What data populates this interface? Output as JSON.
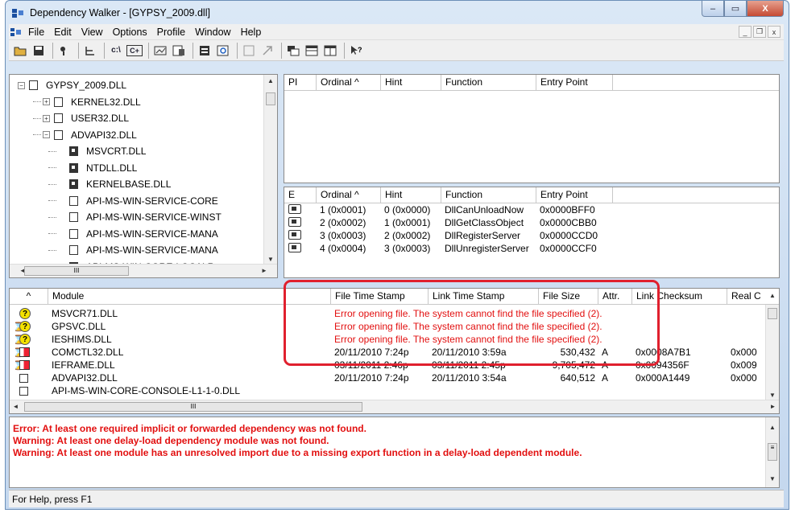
{
  "window": {
    "title": "Dependency Walker - [GYPSY_2009.dll]",
    "buttons": {
      "minimize": "–",
      "maximize": "▭",
      "close": "X"
    }
  },
  "menu": [
    "File",
    "Edit",
    "View",
    "Options",
    "Profile",
    "Window",
    "Help"
  ],
  "mdi_buttons": [
    "_",
    "❐",
    "x"
  ],
  "tree": {
    "scroll_hint": "III",
    "items": [
      {
        "label": "GYPSY_2009.DLL",
        "depth": 0,
        "expander": "−",
        "icon": "module-icon"
      },
      {
        "label": "KERNEL32.DLL",
        "depth": 1,
        "expander": "+",
        "icon": "module-icon"
      },
      {
        "label": "USER32.DLL",
        "depth": 1,
        "expander": "+",
        "icon": "module-icon"
      },
      {
        "label": "ADVAPI32.DLL",
        "depth": 1,
        "expander": "−",
        "icon": "module-icon"
      },
      {
        "label": "MSVCRT.DLL",
        "depth": 2,
        "expander": "",
        "icon": "module-dark-icon"
      },
      {
        "label": "NTDLL.DLL",
        "depth": 2,
        "expander": "",
        "icon": "module-dark-icon"
      },
      {
        "label": "KERNELBASE.DLL",
        "depth": 2,
        "expander": "",
        "icon": "module-dark-icon"
      },
      {
        "label": "API-MS-WIN-SERVICE-CORE",
        "depth": 2,
        "expander": "",
        "icon": "module-icon"
      },
      {
        "label": "API-MS-WIN-SERVICE-WINST",
        "depth": 2,
        "expander": "",
        "icon": "module-icon"
      },
      {
        "label": "API-MS-WIN-SERVICE-MANA",
        "depth": 2,
        "expander": "",
        "icon": "module-icon"
      },
      {
        "label": "API-MS-WIN-SERVICE-MANA",
        "depth": 2,
        "expander": "",
        "icon": "module-icon"
      },
      {
        "label": "API-MS-WIN-CORE-LOCALR",
        "depth": 2,
        "expander": "",
        "icon": "module-dark-icon"
      }
    ]
  },
  "imports": {
    "headers": [
      "PI",
      "Ordinal ^",
      "Hint",
      "Function",
      "Entry Point"
    ]
  },
  "exports": {
    "headers": [
      "E",
      "Ordinal ^",
      "Hint",
      "Function",
      "Entry Point"
    ],
    "rows": [
      {
        "ordinal": "1 (0x0001)",
        "hint": "0 (0x0000)",
        "function": "DllCanUnloadNow",
        "entry": "0x0000BFF0"
      },
      {
        "ordinal": "2 (0x0002)",
        "hint": "1 (0x0001)",
        "function": "DllGetClassObject",
        "entry": "0x0000CBB0"
      },
      {
        "ordinal": "3 (0x0003)",
        "hint": "2 (0x0002)",
        "function": "DllRegisterServer",
        "entry": "0x0000CCD0"
      },
      {
        "ordinal": "4 (0x0004)",
        "hint": "3 (0x0003)",
        "function": "DllUnregisterServer",
        "entry": "0x0000CCF0"
      }
    ]
  },
  "modules": {
    "headers": [
      "^",
      "Module",
      "File Time Stamp",
      "Link Time Stamp",
      "File Size",
      "Attr.",
      "Link Checksum",
      "Real C"
    ],
    "scroll_hint": "III",
    "rows": [
      {
        "icon": "question",
        "hourglass": false,
        "module": "MSVCR71.DLL",
        "error": "Error opening file. The system cannot find the file specified (2)."
      },
      {
        "icon": "question",
        "hourglass": true,
        "module": "GPSVC.DLL",
        "error": "Error opening file. The system cannot find the file specified (2)."
      },
      {
        "icon": "question",
        "hourglass": true,
        "module": "IESHIMS.DLL",
        "error": "Error opening file. The system cannot find the file specified (2)."
      },
      {
        "icon": "module-red",
        "hourglass": true,
        "module": "COMCTL32.DLL",
        "file_ts": "20/11/2010  7:24p",
        "link_ts": "20/11/2010  3:59a",
        "size": "530,432",
        "attr": "A",
        "checksum": "0x0008A7B1",
        "real": "0x000"
      },
      {
        "icon": "module-red",
        "hourglass": true,
        "module": "IEFRAME.DLL",
        "file_ts": "03/11/2011  2:46p",
        "link_ts": "03/11/2011  2:45p",
        "size": "9,705,472",
        "attr": "A",
        "checksum": "0x0094356F",
        "real": "0x009"
      },
      {
        "icon": "module",
        "hourglass": false,
        "module": "ADVAPI32.DLL",
        "file_ts": "20/11/2010  7:24p",
        "link_ts": "20/11/2010  3:54a",
        "size": "640,512",
        "attr": "A",
        "checksum": "0x000A1449",
        "real": "0x000"
      },
      {
        "icon": "module",
        "hourglass": false,
        "module": "API-MS-WIN-CORE-CONSOLE-L1-1-0.DLL",
        "file_ts": "",
        "link_ts": "",
        "size": "",
        "attr": "",
        "checksum": "",
        "real": ""
      }
    ]
  },
  "log": [
    "Error: At least one required implicit or forwarded dependency was not found.",
    "Warning: At least one delay-load dependency module was not found.",
    "Warning: At least one module has an unresolved import due to a missing export function in a delay-load dependent module."
  ],
  "status": "For Help, press F1",
  "colors": {
    "error_text": "#e21010",
    "highlight_box": "#e0202e",
    "title_gradient_top": "#dbe8f6"
  }
}
